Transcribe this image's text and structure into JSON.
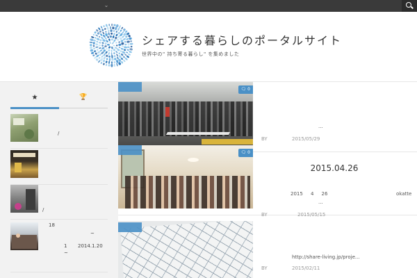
{
  "topbar": {
    "menu_caret": "⌄",
    "search_icon": "search-icon"
  },
  "header": {
    "site_title": "シェアする暮らしのポータルサイト",
    "tagline": "世界中の\" 持ち寄る暮らし\" を集めました"
  },
  "sidebar": {
    "tabs": [
      {
        "icon": "star-icon",
        "glyph": "★",
        "active": true
      },
      {
        "icon": "trophy-icon",
        "glyph": "🏆",
        "active": false
      }
    ],
    "posts": [
      {
        "line1": "",
        "line2": "/"
      },
      {
        "line1": "",
        "line2": ""
      },
      {
        "line1": "",
        "line2": "/"
      },
      {
        "line1": "18",
        "line2": "~",
        "line3": "1       2014.1.20",
        "line4": "~"
      }
    ]
  },
  "main": {
    "cards": [
      {
        "comments": "0",
        "title": "",
        "excerpt": "...",
        "author_prefix": "BY",
        "date": "2015/05/29"
      },
      {
        "comments": "0",
        "title": "2015.04.26",
        "excerpt_left": "2015     4     26",
        "excerpt_right": "okatte",
        "excerpt_more": "...",
        "author_prefix": "BY",
        "date": "2015/05/15"
      },
      {
        "comments": "",
        "title": "",
        "excerpt": "http://share-living.jp/proje...",
        "author_prefix": "BY",
        "date": "2015/02/11"
      }
    ]
  },
  "colors": {
    "accent": "#4a90c6",
    "topbar": "#3a3a3a",
    "sidebar_bg": "#f2f2f2"
  }
}
